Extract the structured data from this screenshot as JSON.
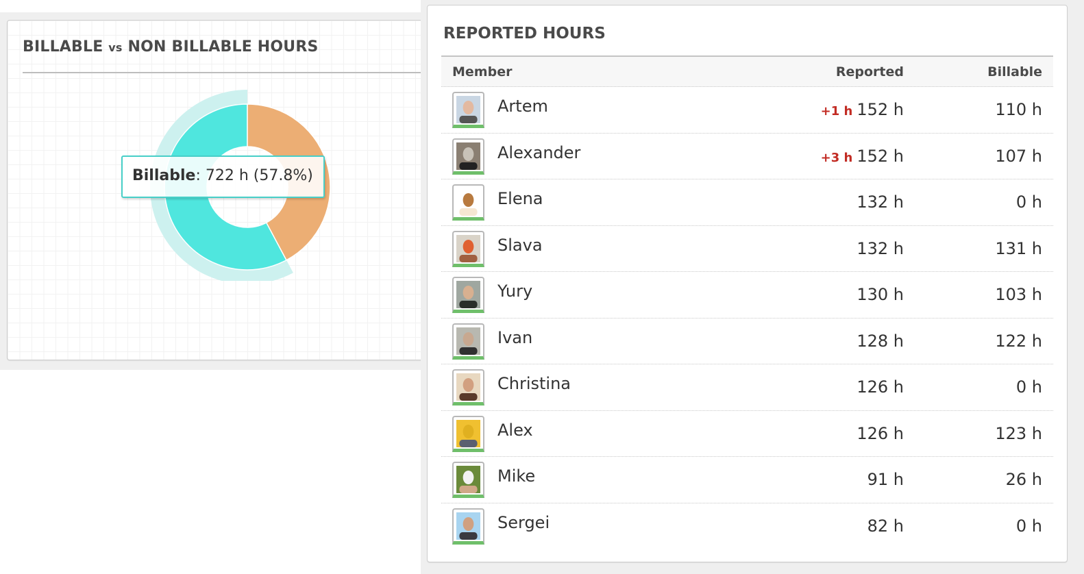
{
  "billable_widget": {
    "title_part1": "BILLABLE",
    "title_vs": "vs",
    "title_part2": "NON BILLABLE HOURS",
    "tooltip": {
      "label": "Billable",
      "value": "722 h (57.8%)"
    },
    "colors": {
      "billable": "#4fe6de",
      "non_billable": "#ecae74",
      "highlight": "#cdf1ef"
    }
  },
  "chart_data": {
    "type": "pie",
    "title": "BILLABLE vs NON BILLABLE HOURS",
    "variant": "donut",
    "categories": [
      "Billable",
      "Non Billable"
    ],
    "values": [
      722,
      527
    ],
    "percent": [
      57.8,
      42.2
    ],
    "units": "h",
    "highlighted": "Billable",
    "legend": "none"
  },
  "reported_widget": {
    "title": "REPORTED HOURS",
    "columns": {
      "member": "Member",
      "reported": "Reported",
      "billable": "Billable"
    },
    "rows": [
      {
        "name": "Artem",
        "delta": "+1 h",
        "reported": "152 h",
        "billable": "110 h",
        "avatar": "photo-man-flag"
      },
      {
        "name": "Alexander",
        "delta": "+3 h",
        "reported": "152 h",
        "billable": "107 h",
        "avatar": "photo-koala"
      },
      {
        "name": "Elena",
        "delta": "",
        "reported": "132 h",
        "billable": "0 h",
        "avatar": "drawing-girl"
      },
      {
        "name": "Slava",
        "delta": "",
        "reported": "132 h",
        "billable": "131 h",
        "avatar": "photo-man-orange"
      },
      {
        "name": "Yury",
        "delta": "",
        "reported": "130 h",
        "billable": "103 h",
        "avatar": "photo-man-dark"
      },
      {
        "name": "Ivan",
        "delta": "",
        "reported": "128 h",
        "billable": "122 h",
        "avatar": "photo-man-glasses"
      },
      {
        "name": "Christina",
        "delta": "",
        "reported": "126 h",
        "billable": "0 h",
        "avatar": "photo-woman"
      },
      {
        "name": "Alex",
        "delta": "",
        "reported": "126 h",
        "billable": "123 h",
        "avatar": "photo-smiley"
      },
      {
        "name": "Mike",
        "delta": "",
        "reported": "91 h",
        "billable": "26 h",
        "avatar": "photo-man-hat"
      },
      {
        "name": "Sergei",
        "delta": "",
        "reported": "82 h",
        "billable": "0 h",
        "avatar": "photo-man-sky"
      }
    ]
  }
}
